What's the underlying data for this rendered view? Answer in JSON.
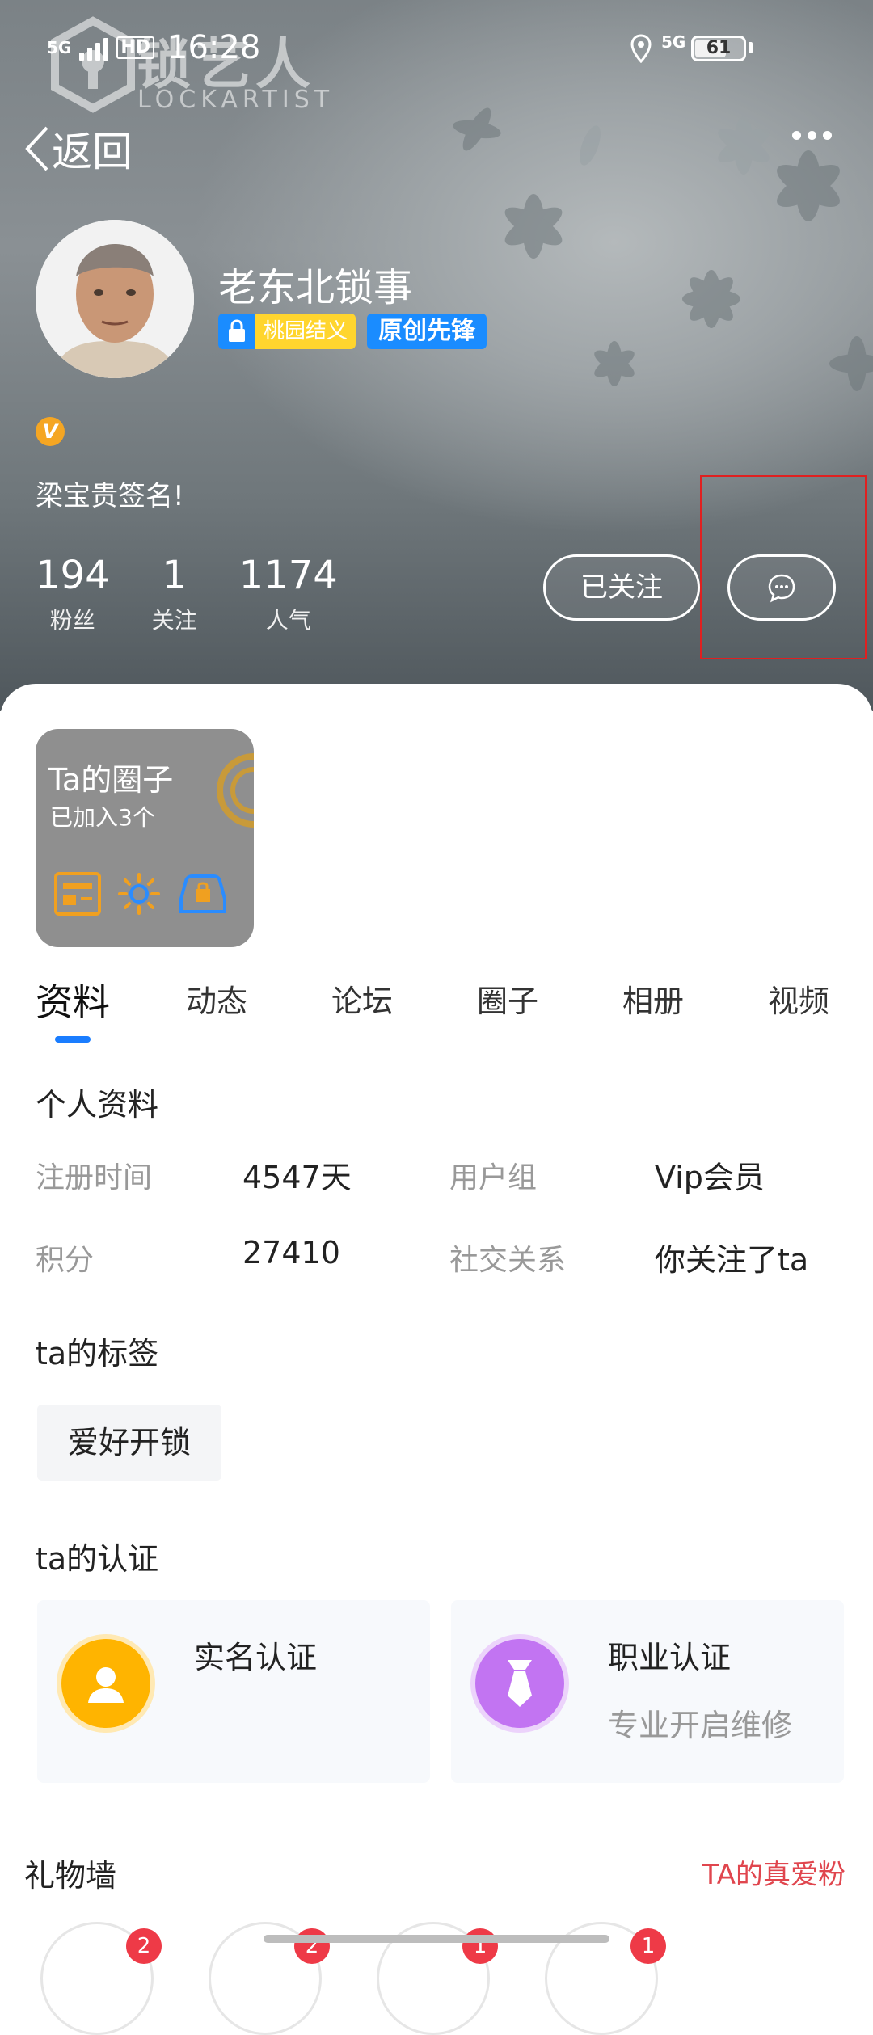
{
  "status_bar": {
    "network": "5G",
    "hd": "HD",
    "time": "16:28",
    "network_right": "5G",
    "battery": "61"
  },
  "watermark": {
    "cn": "锁艺人",
    "en": "LOCKARTIST"
  },
  "nav": {
    "back_label": "返回"
  },
  "profile": {
    "username": "老东北锁事",
    "badge_level": "桃园结义",
    "badge_honor": "原创先锋",
    "vip_mark": "V",
    "signature": "梁宝贵签名!",
    "stats": [
      {
        "value": "194",
        "label": "粉丝"
      },
      {
        "value": "1",
        "label": "关注"
      },
      {
        "value": "1174",
        "label": "人气"
      }
    ],
    "follow_label": "已关注"
  },
  "circle_card": {
    "title": "Ta的圈子",
    "subtitle": "已加入3个"
  },
  "tabs": [
    {
      "label": "资料",
      "active": true
    },
    {
      "label": "动态"
    },
    {
      "label": "论坛"
    },
    {
      "label": "圈子"
    },
    {
      "label": "相册"
    },
    {
      "label": "视频"
    }
  ],
  "personal_info": {
    "title": "个人资料",
    "rows": [
      {
        "label1": "注册时间",
        "value1": "4547天",
        "label2": "用户组",
        "value2": "Vip会员"
      },
      {
        "label1": "积分",
        "value1": "27410",
        "label2": "社交关系",
        "value2": "你关注了ta"
      }
    ]
  },
  "tags": {
    "title": "ta的标签",
    "items": [
      "爱好开锁"
    ]
  },
  "certification": {
    "title": "ta的认证",
    "items": [
      {
        "title": "实名认证",
        "desc": "",
        "color": "#ffb400"
      },
      {
        "title": "职业认证",
        "desc": "专业开启维修",
        "color": "#c274f2"
      }
    ]
  },
  "gift_wall": {
    "title": "礼物墙",
    "link": "TA的真爱粉",
    "badges": [
      "2",
      "2",
      "1",
      "1"
    ]
  },
  "colors": {
    "accent": "#1a7dff",
    "badge_yellow": "#ffd52e",
    "red": "#ee3a47"
  }
}
